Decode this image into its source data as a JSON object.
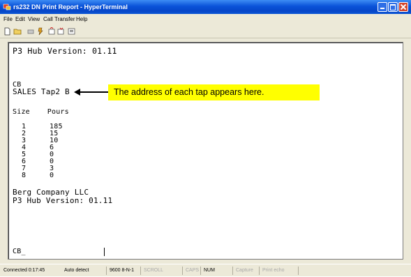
{
  "window": {
    "title": "rs232 DN Print Report - HyperTerminal"
  },
  "menu": [
    "File",
    "Edit",
    "View",
    "Call",
    "Transfer",
    "Help"
  ],
  "toolbar": [
    "new-connection-icon",
    "open-icon",
    "disconnect-icon",
    "dial-icon",
    "send-icon",
    "receive-icon",
    "properties-icon"
  ],
  "terminal": {
    "version_line_1": "P3 Hub Version: 01.11",
    "cb_line": "CB",
    "sales_line": "SALES Tap2 B",
    "header": "Size    Pours",
    "rows": [
      {
        "size": "1",
        "pours": "185"
      },
      {
        "size": "2",
        "pours": "15"
      },
      {
        "size": "3",
        "pours": "10"
      },
      {
        "size": "4",
        "pours": "6"
      },
      {
        "size": "5",
        "pours": "0"
      },
      {
        "size": "6",
        "pours": "0"
      },
      {
        "size": "7",
        "pours": "3"
      },
      {
        "size": "8",
        "pours": "0"
      }
    ],
    "company_line": "Berg Company LLC",
    "version_line_2": "P3 Hub Version: 01.11",
    "prompt": "CB_"
  },
  "callout": {
    "text": "The address of each tap appears here."
  },
  "statusbar": {
    "connected": "Connected 0:17:45",
    "detect": "Auto detect",
    "settings": "9600 8-N-1",
    "scroll": "SCROLL",
    "caps": "CAPS",
    "num": "NUM",
    "capture": "Capture",
    "print_echo": "Print echo"
  }
}
